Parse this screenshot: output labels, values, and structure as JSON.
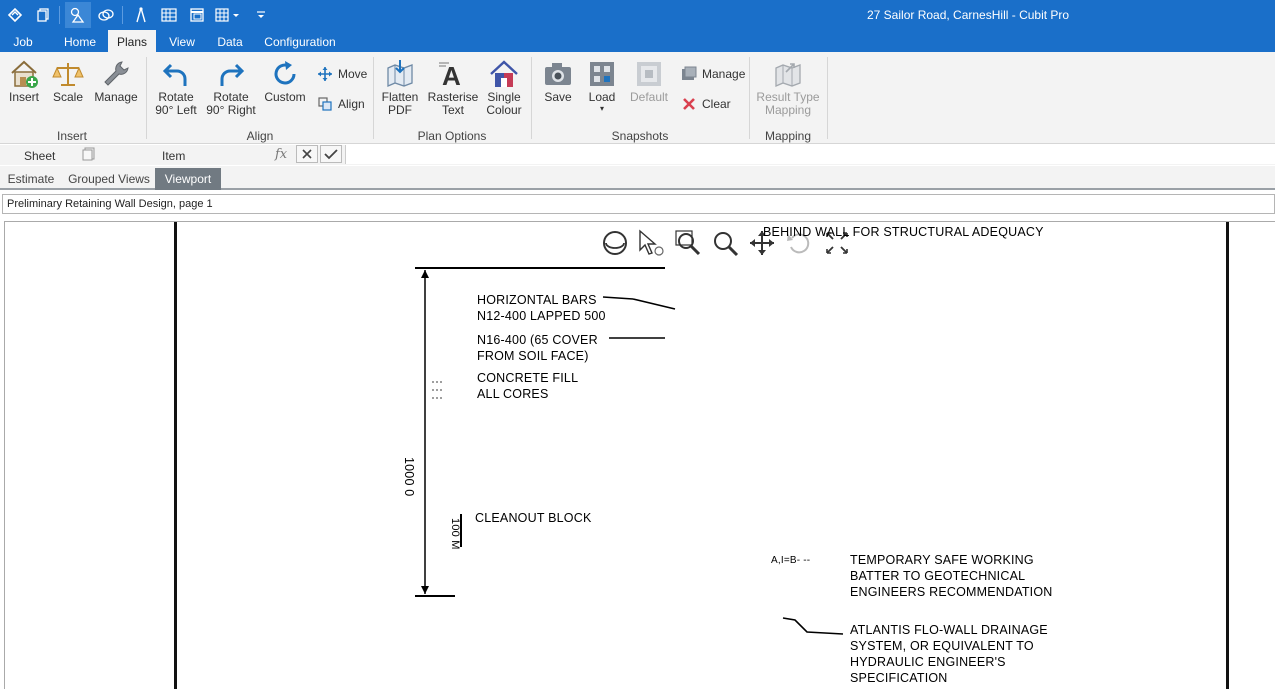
{
  "window": {
    "title": "27 Sailor Road, CarnesHill - Cubit Pro"
  },
  "quick_access": {
    "icons": [
      "cubit-logo-icon",
      "copy-pages-icon",
      "shapes-icon",
      "layers-icon",
      "measure-icon",
      "table-icon",
      "window-icon",
      "grid-icon",
      "customize-icon"
    ]
  },
  "tabs": [
    {
      "label": "Job"
    },
    {
      "label": "Home"
    },
    {
      "label": "Plans"
    },
    {
      "label": "View"
    },
    {
      "label": "Data"
    },
    {
      "label": "Configuration"
    }
  ],
  "active_tab": "Plans",
  "ribbon": {
    "insert_group": {
      "label": "Insert",
      "insert": "Insert",
      "scale": "Scale",
      "manage": "Manage"
    },
    "align_group": {
      "label": "Align",
      "rotate_left_line1": "Rotate",
      "rotate_left_line2": "90° Left",
      "rotate_right_line1": "Rotate",
      "rotate_right_line2": "90° Right",
      "custom": "Custom",
      "move": "Move",
      "align": "Align"
    },
    "plan_options_group": {
      "label": "Plan Options",
      "flatten_line1": "Flatten",
      "flatten_line2": "PDF",
      "rasterise_line1": "Rasterise",
      "rasterise_line2": "Text",
      "single_line1": "Single",
      "single_line2": "Colour"
    },
    "snapshots_group": {
      "label": "Snapshots",
      "save": "Save",
      "load": "Load",
      "default": "Default",
      "manage": "Manage",
      "clear": "Clear"
    },
    "mapping_group": {
      "label": "Mapping",
      "result_line1": "Result Type",
      "result_line2": "Mapping"
    }
  },
  "formula_bar": {
    "sheet_label": "Sheet",
    "item_label": "Item",
    "fx": "fx",
    "value": ""
  },
  "view_tabs": [
    {
      "label": "Estimate"
    },
    {
      "label": "Grouped Views"
    },
    {
      "label": "Viewport"
    }
  ],
  "active_view_tab": "Viewport",
  "document": {
    "name": "Preliminary Retaining Wall Design, page 1"
  },
  "viewport_tools": [
    "orbit-icon",
    "select-icon",
    "zoom-window-icon",
    "zoom-icon",
    "pan-icon",
    "undo-view-icon",
    "fit-icon"
  ],
  "drawing": {
    "header_note": "BEHIND WALL FOR STRUCTURAL ADEQUACY",
    "horizontal_bars_1": "HORIZONTAL BARS",
    "horizontal_bars_2": "N12-400 LAPPED 500",
    "n16_1": "N16-400 (65 COVER",
    "n16_2": "FROM SOIL FACE)",
    "concrete_1": "CONCRETE FILL",
    "concrete_2": "ALL  CORES",
    "cleanout": "CLEANOUT BLOCK",
    "dim_main": "1000 0",
    "dim_small": "100 M",
    "temp_1": "TEMPORARY SAFE WORKING",
    "temp_2": "BATTER TO GEOTECHNICAL",
    "temp_3": "ENGINEERS RECOMMENDATION",
    "atlantis_1": "ATLANTIS FLO-WALL DRAINAGE",
    "atlantis_2": "SYSTEM, OR EQUIVALENT TO",
    "atlantis_3": "HYDRAULIC ENGINEER'S",
    "atlantis_4": "SPECIFICATION",
    "leader_label": "A,I=B- --"
  }
}
